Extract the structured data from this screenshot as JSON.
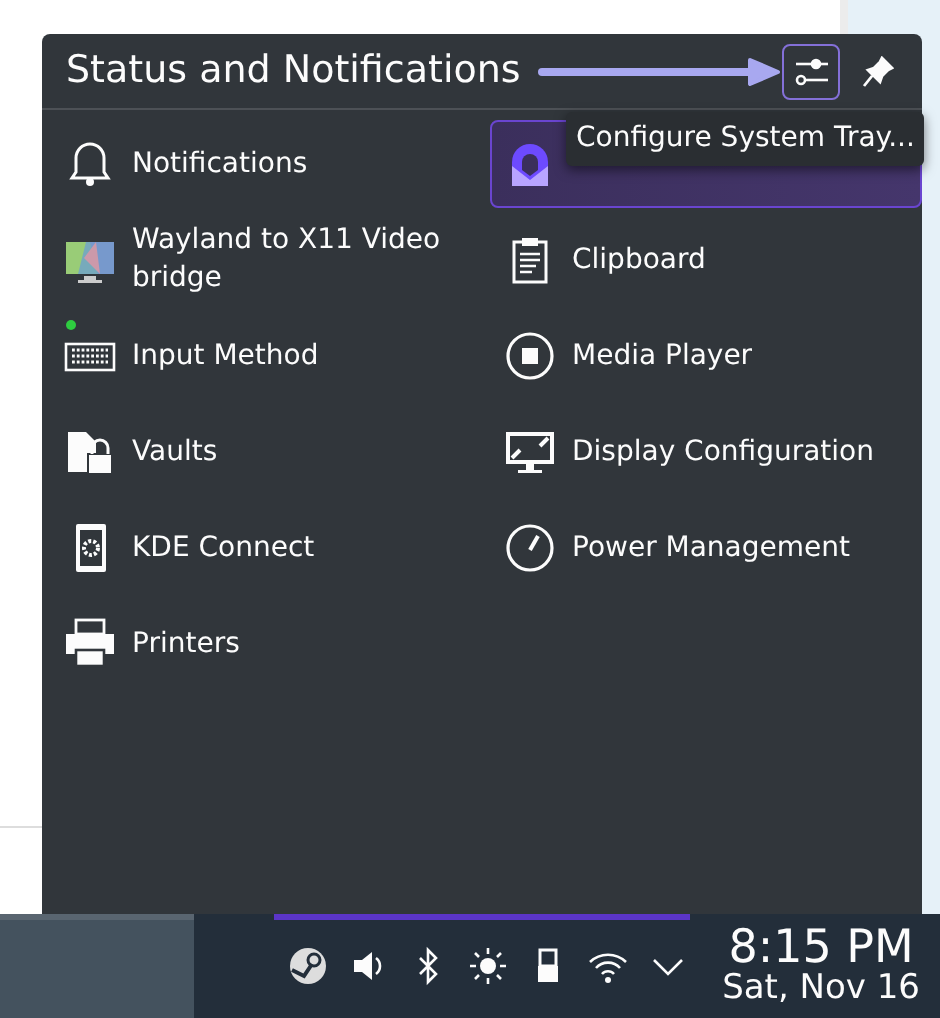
{
  "popup": {
    "title": "Status and Notifications",
    "configure_button": {
      "selected": true
    },
    "tooltip": "Configure System Tray...",
    "items": [
      {
        "label": "Notifications",
        "selected": false,
        "indicator": false
      },
      {
        "selected": true,
        "indicator": false
      },
      {
        "label": "Wayland to X11 Video bridge",
        "selected": false,
        "indicator": false
      },
      {
        "label": "Clipboard",
        "selected": false,
        "indicator": false
      },
      {
        "label": "Input Method",
        "selected": false,
        "indicator": true
      },
      {
        "label": "Media Player",
        "selected": false,
        "indicator": false
      },
      {
        "label": "Vaults",
        "selected": false,
        "indicator": false
      },
      {
        "label": "Display Configuration",
        "selected": false,
        "indicator": false
      },
      {
        "label": "KDE Connect",
        "selected": false,
        "indicator": false
      },
      {
        "label": "Power Management",
        "selected": false,
        "indicator": false
      },
      {
        "label": "Printers",
        "selected": false,
        "indicator": false
      }
    ]
  },
  "taskbar": {
    "time": "8:15 PM",
    "date": "Sat, Nov 16"
  }
}
